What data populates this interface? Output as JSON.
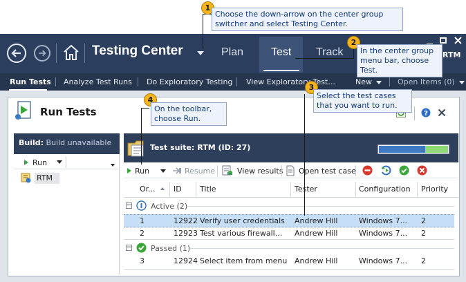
{
  "window": {
    "title": "Testing Center",
    "center_tabs": [
      "Plan",
      "Test",
      "Track"
    ],
    "active_tab": "Test",
    "project_label": "RTM",
    "controls": [
      "minimize",
      "maximize",
      "close"
    ]
  },
  "nav": {
    "back_icon": "back-arrow-icon",
    "forward_icon": "forward-arrow-icon",
    "home_icon": "home-icon",
    "group_switcher_icon": "chevron-down-icon"
  },
  "menu": {
    "items": [
      "Run Tests",
      "Analyze Test Runs",
      "Do Exploratory Testing",
      "View Exploratory Test..."
    ],
    "active": "Run Tests",
    "new_label": "New",
    "open_items_label": "Open Items (0)"
  },
  "panel": {
    "title": "Run Tests",
    "refresh_icon": "refresh-icon",
    "help_icon": "help-icon",
    "close_icon": "close-icon"
  },
  "left": {
    "build_label": "Build:",
    "build_value": "Build unavailable",
    "run_label": "Run",
    "tree_item": "RTM"
  },
  "suite": {
    "label": "Test suite:  RTM (ID: 27)",
    "progress": {
      "blocked": 0.0,
      "active": 0.67,
      "passed": 0.33
    },
    "colors": {
      "active": "#3f79c4",
      "passed": "#8fdc76"
    }
  },
  "toolbar": {
    "run": "Run",
    "resume": "Resume",
    "view_results": "View results",
    "open_test_case": "Open test case",
    "status_icons": [
      "block-icon",
      "reset-icon",
      "pass-icon",
      "fail-icon"
    ]
  },
  "table": {
    "columns": [
      "Or...",
      "ID",
      "Title",
      "Tester",
      "Configuration",
      "Priority"
    ],
    "groups": [
      {
        "label": "Active (2)",
        "icon": "active-icon",
        "rows": [
          {
            "order": "1",
            "id": "12922",
            "title": "Verify user credentials",
            "tester": "Andrew Hill",
            "config": "Windows 7...",
            "priority": "2",
            "selected": true
          },
          {
            "order": "2",
            "id": "12923",
            "title": "Test various firewall...",
            "tester": "Andrew Hill",
            "config": "Windows 7...",
            "priority": "2",
            "selected": false
          }
        ]
      },
      {
        "label": "Passed (1)",
        "icon": "passed-icon",
        "rows": [
          {
            "order": "3",
            "id": "12924",
            "title": "Select item from menu",
            "tester": "Andrew Hill",
            "config": "Windows 7...",
            "priority": "2",
            "selected": false
          }
        ]
      }
    ]
  },
  "callouts": [
    {
      "num": "1",
      "text": "Choose the down-arrow on the center group switcher and select Testing Center."
    },
    {
      "num": "2",
      "text": "In the center group menu bar, choose Test."
    },
    {
      "num": "3",
      "text": "Select the test cases that you want to run."
    },
    {
      "num": "4",
      "text": "On the toolbar, choose Run."
    }
  ]
}
